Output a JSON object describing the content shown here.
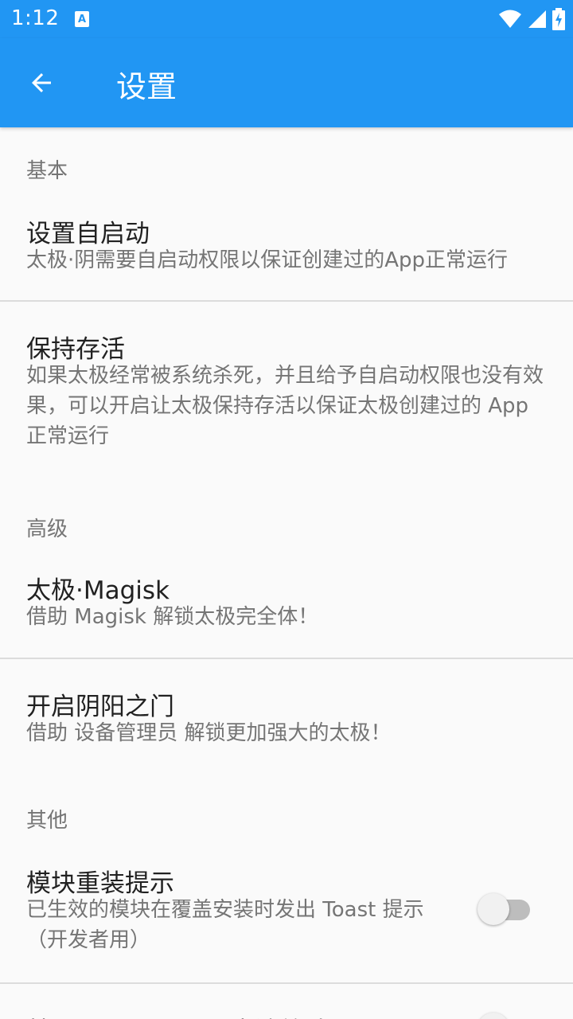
{
  "status_bar": {
    "time": "1:12",
    "notification_icon": "A",
    "icons": [
      "wifi-icon",
      "signal-icon",
      "battery-charging-icon"
    ]
  },
  "app_bar": {
    "title": "设置",
    "back_icon": "arrow-left-icon",
    "color": "#2196f3"
  },
  "sections": {
    "basic": {
      "header": "基本",
      "autostart": {
        "title": "设置自启动",
        "summary": "太极·阴需要自启动权限以保证创建过的App正常运行"
      },
      "keepalive": {
        "title": "保持存活",
        "summary": "如果太极经常被系统杀死，并且给予自启动权限也没有效果，可以开启让太极保持存活以保证太极创建过的 App 正常运行"
      }
    },
    "advanced": {
      "header": "高级",
      "magisk": {
        "title": "太极·Magisk",
        "summary": "借助 Magisk 解锁太极完全体！"
      },
      "yinyang": {
        "title": "开启阴阳之门",
        "summary": "借助 设备管理员 解锁更加强大的太极！"
      }
    },
    "other": {
      "header": "其他",
      "reinstall_hint": {
        "title": "模块重装提示",
        "summary": "已生效的模块在覆盖安装时发出 Toast 提示（开发者用）",
        "enabled": false
      },
      "next_partial": {
        "title": "禁用 App Center 崩溃统计",
        "enabled": false
      }
    }
  }
}
